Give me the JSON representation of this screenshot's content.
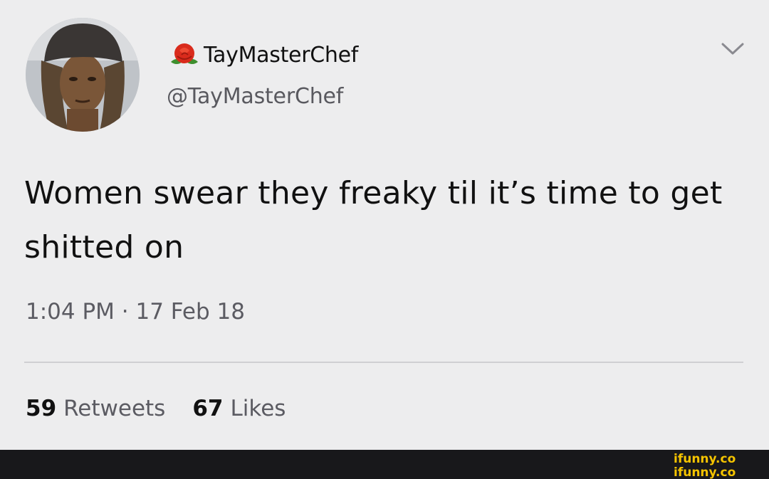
{
  "tweet": {
    "display_name": "TayMasterChef",
    "handle": "@TayMasterChef",
    "text": "Women swear they freaky til it’s time to get shitted on",
    "timestamp": "1:04 PM · 17 Feb 18",
    "retweets": {
      "count": "59",
      "label": "Retweets"
    },
    "likes": {
      "count": "67",
      "label": "Likes"
    },
    "name_emoji": "rose-icon",
    "menu_icon": "chevron-down-icon"
  },
  "watermark": {
    "text": "ifunny.co"
  },
  "colors": {
    "background": "#ededee",
    "text_primary": "#111111",
    "text_secondary": "#5b5b62",
    "footer": "#18181b",
    "watermark": "#f5c400"
  }
}
